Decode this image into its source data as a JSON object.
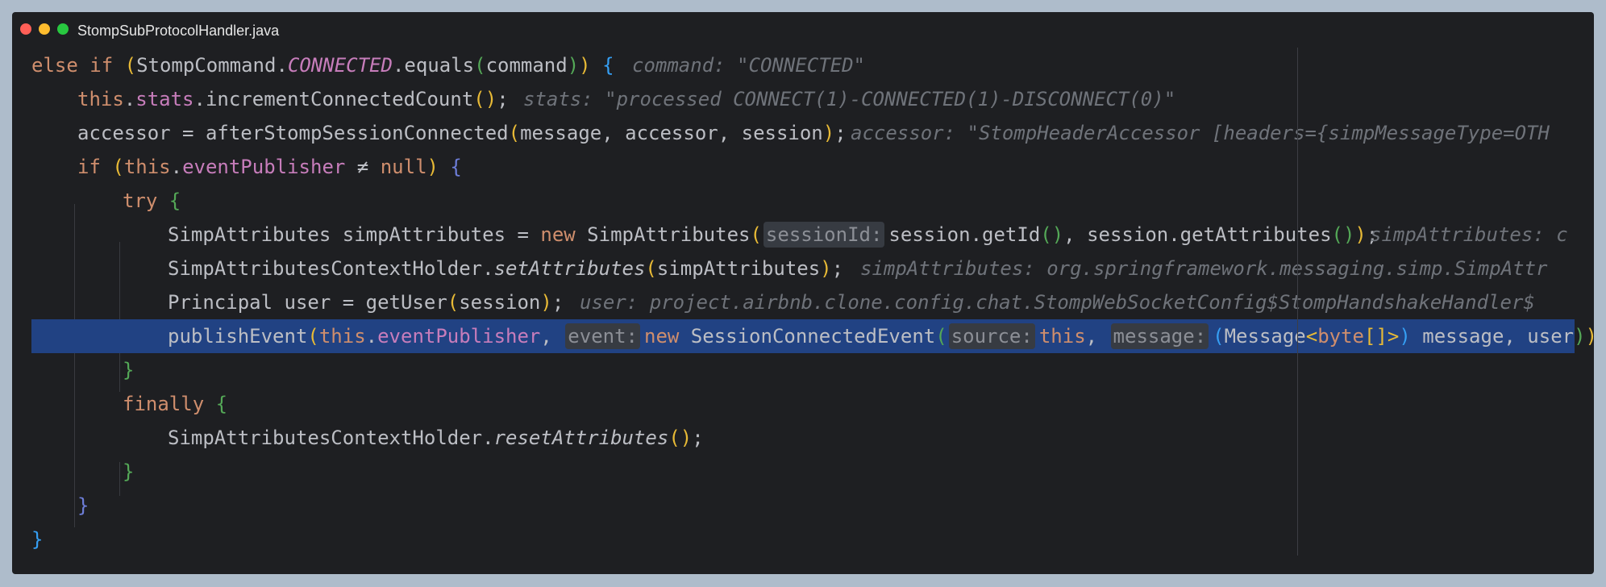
{
  "window": {
    "title": "StompSubProtocolHandler.java"
  },
  "code": {
    "l1": {
      "else": "else ",
      "if": "if ",
      "paren_open": "(",
      "cls": "StompCommand.",
      "const": "CONNECTED",
      "method": ".equals",
      "inner_open": "(",
      "arg": "command",
      "inner_close": ")",
      "paren_close": ")",
      "space": " ",
      "brace": "{",
      "hint": "command: \"CONNECTED\""
    },
    "l2": {
      "this": "this",
      "dot": ".",
      "field": "stats",
      "method": ".incrementConnectedCount",
      "parens": "()",
      "semi": ";",
      "hint": "stats: \"processed CONNECT(1)-CONNECTED(1)-DISCONNECT(0)\""
    },
    "l3": {
      "lhs": "accessor = afterStompSessionConnected",
      "open": "(",
      "args": "message, accessor, session",
      "close": ")",
      "semi": ";",
      "hint": "accessor: \"StompHeaderAccessor [headers={simpMessageType=OTH"
    },
    "l4": {
      "if": "if ",
      "open": "(",
      "this": "this",
      "dot": ".",
      "field": "eventPublisher",
      "neq": " ≠ ",
      "null": "null",
      "close": ")",
      "space": " ",
      "brace": "{"
    },
    "l5": {
      "try": "try ",
      "brace": "{"
    },
    "l6": {
      "lhs": "SimpAttributes simpAttributes = ",
      "new": "new ",
      "ctor": "SimpAttributes",
      "open": "(",
      "inlay": "sessionId:",
      "a1": "session.getId",
      "a1p": "()",
      "sep": ", ",
      "a2": "session.getAttributes",
      "a2p": "()",
      "close": ")",
      "semi": ";",
      "hint": "simpAttributes: c"
    },
    "l7": {
      "cls": "SimpAttributesContextHolder.",
      "method": "setAttributes",
      "open": "(",
      "arg": "simpAttributes",
      "close": ")",
      "semi": ";",
      "hint": "simpAttributes: org.springframework.messaging.simp.SimpAttr"
    },
    "l8": {
      "lhs": "Principal user = getUser",
      "open": "(",
      "arg": "session",
      "close": ")",
      "semi": ";",
      "hint": "user: project.airbnb.clone.config.chat.StompWebSocketConfig$StompHandshakeHandler$"
    },
    "l9": {
      "call": "publishEvent",
      "open": "(",
      "this": "this",
      "dot": ".",
      "field": "eventPublisher",
      "sep": ",",
      "inlay_event": "event:",
      "new": "new ",
      "ctor": "SessionConnectedEvent",
      "open2": "(",
      "inlay_source": "source:",
      "this2": "this",
      "sep2": ",",
      "inlay_message": "message:",
      "cast_open": "(",
      "cast_type": "Message",
      "lt": "<",
      "byte": "byte",
      "brackets": "[]",
      "gt": ">",
      "cast_close": ")",
      "rest": " message, user",
      "close2": ")",
      "close": ")",
      "semi": ";"
    },
    "l10": {
      "brace": "}"
    },
    "l11": {
      "finally": "finally ",
      "brace": "{"
    },
    "l12": {
      "cls": "SimpAttributesContextHolder.",
      "method": "resetAttributes",
      "parens": "()",
      "semi": ";"
    },
    "l13": {
      "brace": "}"
    },
    "l14": {
      "brace": "}"
    },
    "l15": {
      "brace": "}"
    }
  }
}
